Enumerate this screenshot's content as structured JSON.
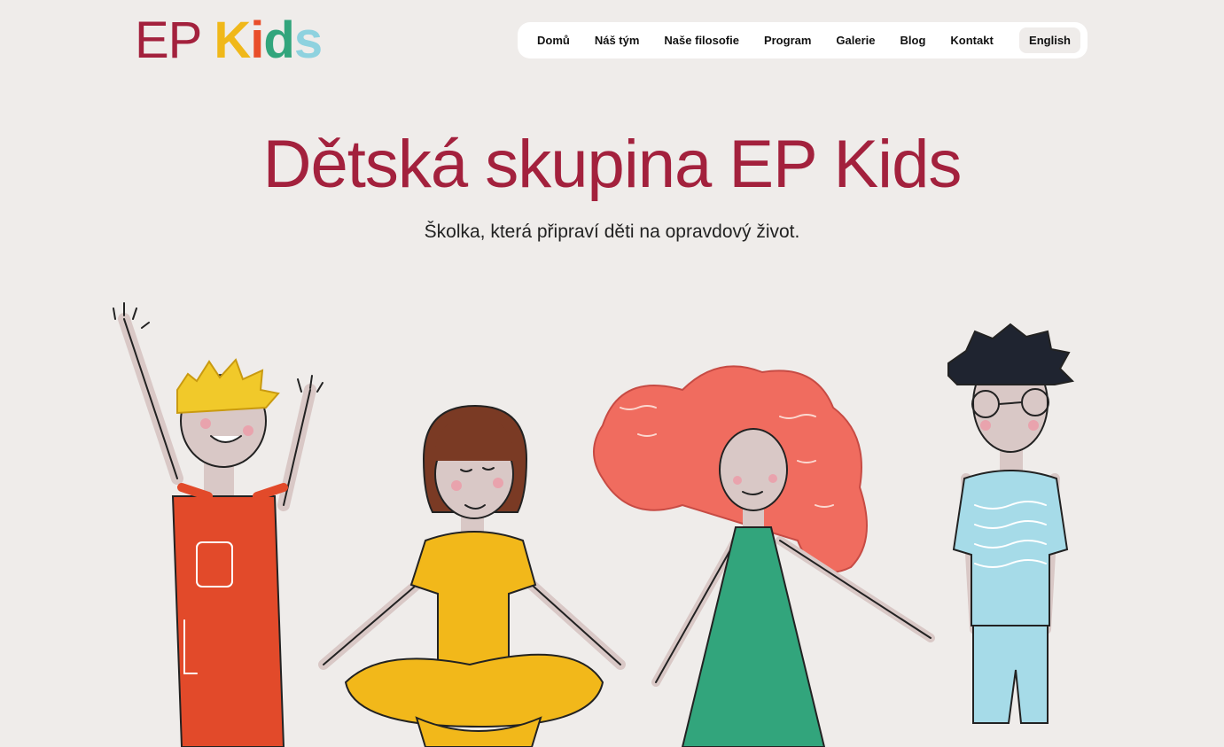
{
  "logo": {
    "ep": "EP",
    "kids_k": "K",
    "kids_i": "i",
    "kids_d": "d",
    "kids_s": "s"
  },
  "nav": {
    "items": [
      {
        "label": "Domů"
      },
      {
        "label": "Náš tým"
      },
      {
        "label": "Naše filosofie"
      },
      {
        "label": "Program"
      },
      {
        "label": "Galerie"
      },
      {
        "label": "Blog"
      },
      {
        "label": "Kontakt"
      }
    ],
    "language": "English"
  },
  "hero": {
    "title": "Dětská skupina EP Kids",
    "subtitle": "Školka, která připraví děti na opravdový život."
  },
  "colors": {
    "brand_red": "#a3213d",
    "background": "#efecea",
    "logo_yellow": "#f0b81a",
    "logo_orange": "#e94e2a",
    "logo_green": "#32a57c",
    "logo_blue": "#8ed2df"
  }
}
